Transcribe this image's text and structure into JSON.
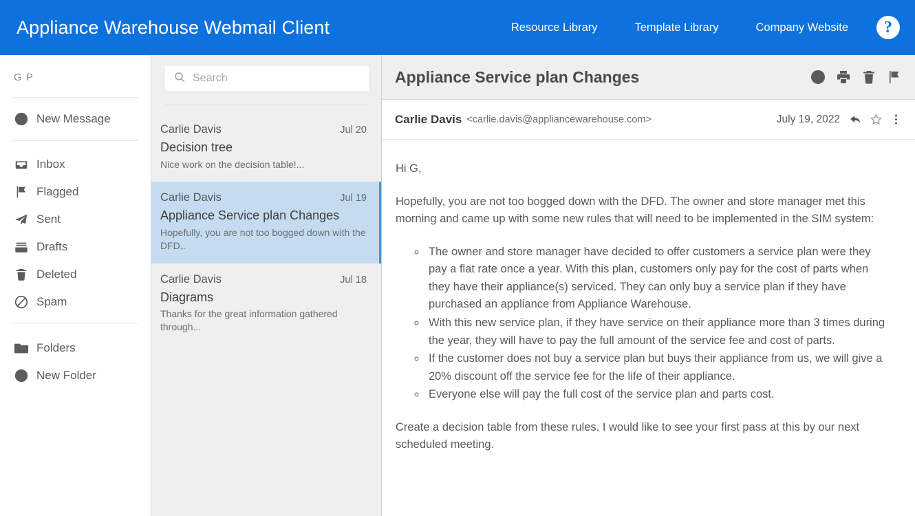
{
  "header": {
    "title": "Appliance Warehouse Webmail Client",
    "nav": [
      {
        "label": "Resource Library"
      },
      {
        "label": "Template Library"
      },
      {
        "label": "Company Website"
      }
    ],
    "help_glyph": "?",
    "brand_color": "#0d72de"
  },
  "sidebar": {
    "user_initials": "G P",
    "new_message_label": "New Message",
    "folders": [
      {
        "label": "Inbox",
        "icon": "inbox-icon"
      },
      {
        "label": "Flagged",
        "icon": "flag-icon"
      },
      {
        "label": "Sent",
        "icon": "paper-plane-icon"
      },
      {
        "label": "Drafts",
        "icon": "drafts-icon"
      },
      {
        "label": "Deleted",
        "icon": "trash-icon"
      },
      {
        "label": "Spam",
        "icon": "block-icon"
      }
    ],
    "folders_label": "Folders",
    "new_folder_label": "New Folder"
  },
  "search": {
    "placeholder": "Search",
    "value": "",
    "icon": "search-icon"
  },
  "message_list": {
    "selected_index": 1,
    "selected_bg": "#c5dcf0",
    "selected_accent": "#4a90d9",
    "items": [
      {
        "sender": "Carlie Davis",
        "date": "Jul 20",
        "subject": "Decision tree",
        "preview": "Nice work on the decision table!..."
      },
      {
        "sender": "Carlie Davis",
        "date": "Jul 19",
        "subject": "Appliance Service plan Changes",
        "preview": "Hopefully, you are not too bogged down with the DFD.."
      },
      {
        "sender": "Carlie Davis",
        "date": "Jul 18",
        "subject": "Diagrams",
        "preview": "Thanks for the great information gathered through..."
      }
    ]
  },
  "reader": {
    "subject": "Appliance Service plan Changes",
    "actions": [
      {
        "name": "add-icon"
      },
      {
        "name": "print-icon"
      },
      {
        "name": "delete-icon"
      },
      {
        "name": "flag-icon"
      }
    ],
    "sender_name": "Carlie Davis",
    "sender_email": "<carlie.davis@appliancewarehouse.com>",
    "sent_date": "July 19, 2022",
    "sender_actions": [
      {
        "name": "reply-icon"
      },
      {
        "name": "star-icon"
      },
      {
        "name": "more-vertical-icon"
      }
    ],
    "body": {
      "greeting": "Hi G,",
      "intro": "Hopefully, you are not too bogged down with the DFD. The owner and store manager met this morning and came up with some new rules that will need to be implemented in the SIM system:",
      "rules": [
        "The owner and store manager have decided to offer customers a service plan were they pay a flat rate once a year. With this plan, customers only pay for the cost of parts when they have their appliance(s) serviced. They can only buy a service plan if they have purchased an appliance from Appliance Warehouse.",
        "With this new service plan, if they have service on their appliance more than 3 times during the year, they will have to pay the full amount of the service fee and cost of parts.",
        "If the customer does not buy a service plan but buys their appliance from us, we will give a 20% discount off the service fee for the life of their appliance.",
        "Everyone else will pay the full cost of the service plan and parts cost."
      ],
      "closing": "Create a decision table from these rules. I would like to see your first pass at this by our next scheduled meeting."
    }
  }
}
